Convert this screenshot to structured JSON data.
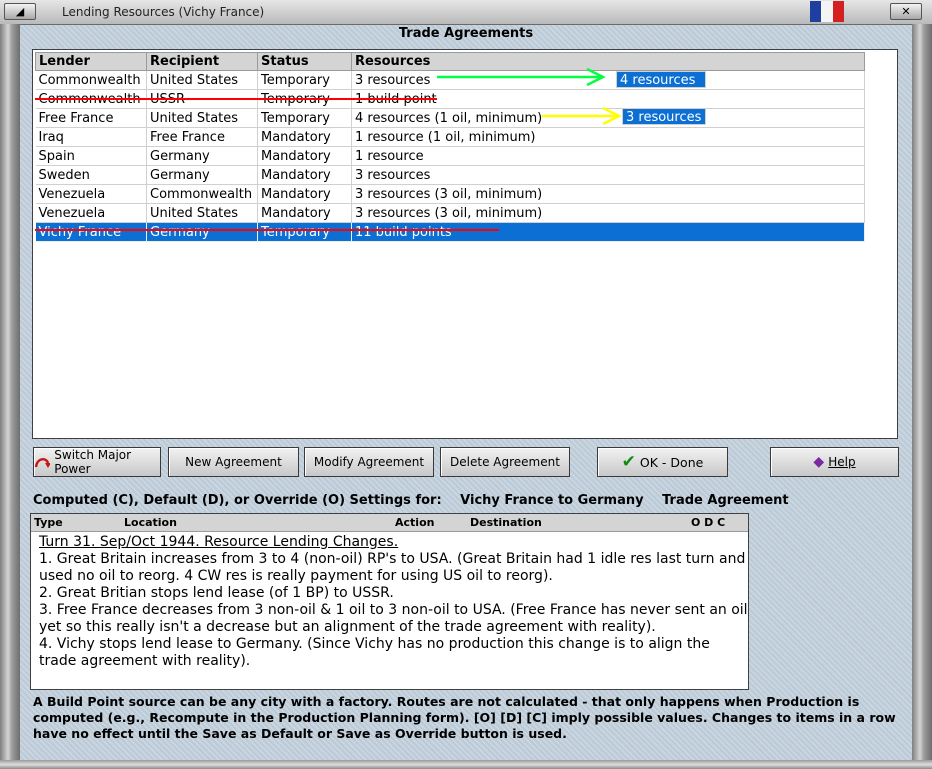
{
  "window": {
    "title": "Lending Resources (Vichy France)"
  },
  "section_title": "Trade Agreements",
  "table": {
    "headers": [
      "Lender",
      "Recipient",
      "Status",
      "Resources"
    ],
    "rows": [
      [
        "Commonwealth",
        "United States",
        "Temporary",
        "3 resources"
      ],
      [
        "Commonwealth",
        "USSR",
        "Temporary",
        "1 build point"
      ],
      [
        "Free France",
        "United States",
        "Temporary",
        "4 resources (1 oil, minimum)"
      ],
      [
        "Iraq",
        "Free France",
        "Mandatory",
        "1 resource (1 oil, minimum)"
      ],
      [
        "Spain",
        "Germany",
        "Mandatory",
        "1 resource"
      ],
      [
        "Sweden",
        "Germany",
        "Mandatory",
        "3 resources"
      ],
      [
        "Venezuela",
        "Commonwealth",
        "Mandatory",
        "3 resources (3 oil, minimum)"
      ],
      [
        "Venezuela",
        "United States",
        "Mandatory",
        "3 resources (3 oil, minimum)"
      ],
      [
        "Vichy France",
        "Germany",
        "Temporary",
        "11 build points"
      ]
    ],
    "selected_row": 8
  },
  "annotations": {
    "row0_new": "4 resources",
    "row2_new": "3 resources",
    "green": "#00ff40",
    "yellow": "#ffff00",
    "red": "#ff0000"
  },
  "buttons": {
    "switch": "Switch Major Power",
    "new": "New Agreement",
    "modify": "Modify Agreement",
    "delete": "Delete Agreement",
    "ok": "OK - Done",
    "help": "Help"
  },
  "settings": {
    "label": "Computed (C), Default (D), or Override (O) Settings for:",
    "target": "Vichy France to Germany",
    "kind": "Trade Agreement"
  },
  "notes": {
    "headers": {
      "type": "Type",
      "location": "Location",
      "action": "Action",
      "destination": "Destination",
      "odc": "O D C"
    },
    "lines": [
      "Turn 31.  Sep/Oct 1944.  Resource Lending Changes.",
      "1. Great Britain increases from 3 to 4 (non-oil) RP's to USA.  (Great Britain had 1 idle res last turn and used no oil to reorg.  4 CW res is really payment for using US oil to reorg).",
      "2. Great Britian stops lend lease (of 1 BP) to USSR.",
      "3. Free France decreases from 3 non-oil & 1 oil to 3 non-oil to USA.  (Free France has never sent an oil yet so this really isn't a decrease but an alignment of the trade agreement with reality).",
      "4. Vichy stops lend lease to Germany.  (Since Vichy has no production this change is to align the trade agreement with reality)."
    ]
  },
  "footer": "A Build Point source can be any city with a factory. Routes are not calculated - that only happens when Production is computed (e.g., Recompute in the Production Planning form).  [O] [D] [C] imply possible values.  Changes to items in a row have no effect until the Save as Default or Save as Override button is used."
}
